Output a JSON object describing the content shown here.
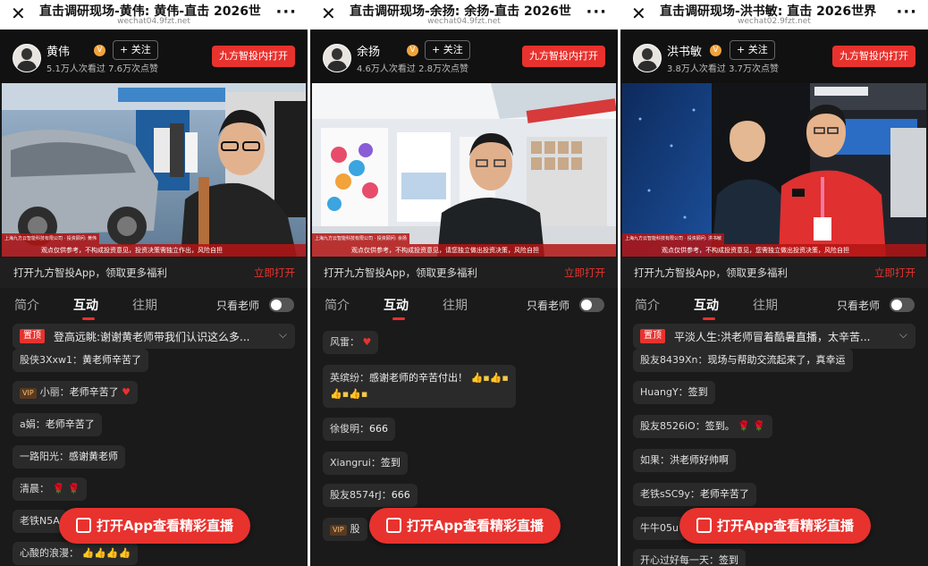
{
  "phones": [
    {
      "title": "直击调研现场-黄伟: 黄伟-直击 2026世",
      "domain": "wechat04.9fzt.net",
      "anchor_name": "黄伟",
      "follow": "+ 关注",
      "stats": "5.1万人次看过 7.6万次点赞",
      "open_in_app": "九方智投内打开",
      "promo_text": "打开九方智投App，领取更多福利",
      "promo_link": "立即打开",
      "tabs": [
        "简介",
        "互动",
        "往期"
      ],
      "only_teacher": "只看老师",
      "pinned_tag": "置顶",
      "pinned_text": "登高远眺:谢谢黄老师带我们认识这么多...",
      "messages": [
        {
          "user": "股侠3Xxw1：",
          "text": "黄老师辛苦了"
        },
        {
          "vip": "VIP",
          "user": "小丽：",
          "text": "老师辛苦了",
          "emoji": "♥"
        },
        {
          "user": "a娟：",
          "text": "老师辛苦了"
        },
        {
          "user": "一路阳光：",
          "text": "感谢黄老师"
        },
        {
          "user": "清晨：",
          "text": "",
          "emoji": "🌹 🌹"
        },
        {
          "user": "老铁N5A",
          "text": ""
        },
        {
          "user": "心酸的浪漫：",
          "text": "",
          "emoji": "👍👍👍👍"
        }
      ],
      "cta": "打开App查看精彩直播",
      "company": "上海九方云智能科技有限公司 · 投资顾问: 黄伟",
      "disclaimer": "观点仅供参考，不构成投资意见，投资决策需独立作出，风险自担"
    },
    {
      "title": "直击调研现场-余扬: 余扬-直击 2026世",
      "domain": "wechat04.9fzt.net",
      "anchor_name": "余扬",
      "follow": "+ 关注",
      "stats": "4.6万人次看过 2.8万次点赞",
      "open_in_app": "九方智投内打开",
      "promo_text": "打开九方智投App，领取更多福利",
      "promo_link": "立即打开",
      "tabs": [
        "简介",
        "互动",
        "往期"
      ],
      "only_teacher": "只看老师",
      "messages": [
        {
          "user": "风雷：",
          "text": "",
          "emoji": "♥"
        },
        {
          "user": "英缤纷：",
          "text": "感谢老师的辛苦付出！",
          "emoji": "👍▪👍▪",
          "emoji2": "👍▪👍▪"
        },
        {
          "user": "徐俊明：",
          "text": "666"
        },
        {
          "user": "Xiangrui：",
          "text": "签到"
        },
        {
          "user": "股友8574rJ：",
          "text": "666"
        },
        {
          "vip": "VIP",
          "user": "股",
          "text": ""
        }
      ],
      "cta": "打开App查看精彩直播",
      "company": "上海九方云智能科技有限公司 · 投资顾问: 余扬",
      "disclaimer": "观点仅供参考，不构成投资意见，请您独立做出投资决策，风险自担",
      "cert": "登记编号:A0740623030001"
    },
    {
      "title": "直击调研现场-洪书敏: 直击 2026世界",
      "domain": "wechat02.9fzt.net",
      "anchor_name": "洪书敏",
      "follow": "+ 关注",
      "stats": "3.8万人次看过 3.7万次点赞",
      "open_in_app": "九方智投内打开",
      "promo_text": "打开九方智投App，领取更多福利",
      "promo_link": "立即打开",
      "tabs": [
        "简介",
        "互动",
        "往期"
      ],
      "only_teacher": "只看老师",
      "pinned_tag": "置顶",
      "pinned_text": "平淡人生:洪老师冒着酷暑直播，太辛苦...",
      "messages": [
        {
          "user": "股友8439Xn：",
          "text": "现场与帮助交流起来了，真幸运"
        },
        {
          "user": "HuangY：",
          "text": "签到"
        },
        {
          "user": "股友8526iO：",
          "text": "签到。",
          "emoji": "🌹 🌹"
        },
        {
          "user": "如果：",
          "text": "洪老师好帅啊"
        },
        {
          "user": "老铁sSC9y：",
          "text": "老师辛苦了"
        },
        {
          "user": "牛牛05u",
          "text": ""
        },
        {
          "user": "开心过好每一天：",
          "text": "签到"
        }
      ],
      "cta": "打开App查看精彩直播",
      "company": "上海九方云智能科技有限公司 · 投资顾问: 洪书敏",
      "disclaimer": "观点仅供参考，不构成投资意见，您需独立做出投资决策，风险自担"
    }
  ]
}
